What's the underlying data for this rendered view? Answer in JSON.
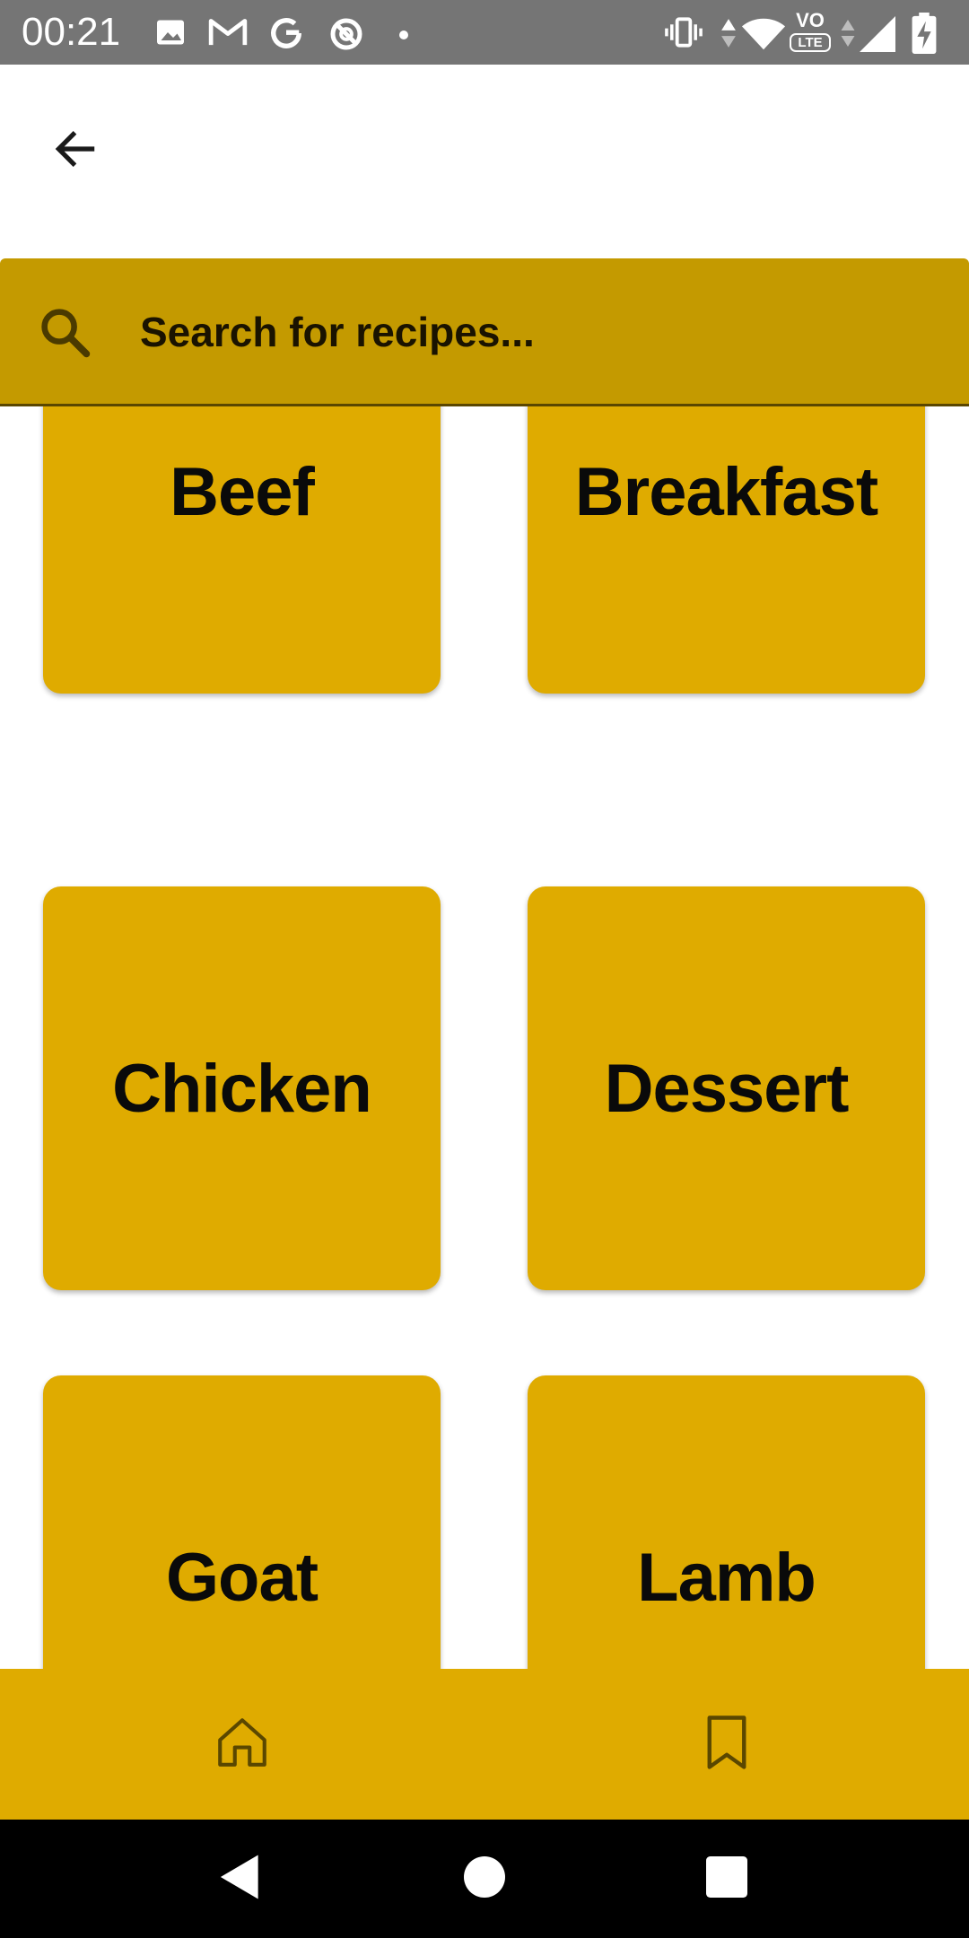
{
  "status_bar": {
    "time": "00:21",
    "left_icons": [
      "image-icon",
      "gmail-icon",
      "google-icon",
      "data-saver-icon",
      "dot-icon"
    ],
    "right_icons": [
      "vibrate-icon",
      "data-arrows-icon",
      "wifi-icon",
      "volte-icon",
      "signal-icon",
      "battery-charging-icon"
    ],
    "volte_label": "VO",
    "lte_label": "LTE"
  },
  "app_bar": {
    "back_icon": "arrow-back-icon"
  },
  "search": {
    "placeholder": "Search for recipes...",
    "value": "",
    "icon": "search-icon"
  },
  "categories": [
    {
      "label": "Beef"
    },
    {
      "label": "Breakfast"
    },
    {
      "label": "Chicken"
    },
    {
      "label": "Dessert"
    },
    {
      "label": "Goat"
    },
    {
      "label": "Lamb"
    }
  ],
  "bottom_nav": {
    "items": [
      {
        "icon": "home-icon"
      },
      {
        "icon": "bookmark-icon"
      }
    ]
  },
  "system_nav": {
    "items": [
      "back-triangle-icon",
      "home-circle-icon",
      "recents-square-icon"
    ]
  },
  "colors": {
    "status_bar": "#757575",
    "search_bar": "#c49a00",
    "tile": "#dfab00",
    "bottom_nav": "#dfab00",
    "system_nav": "#000000"
  }
}
